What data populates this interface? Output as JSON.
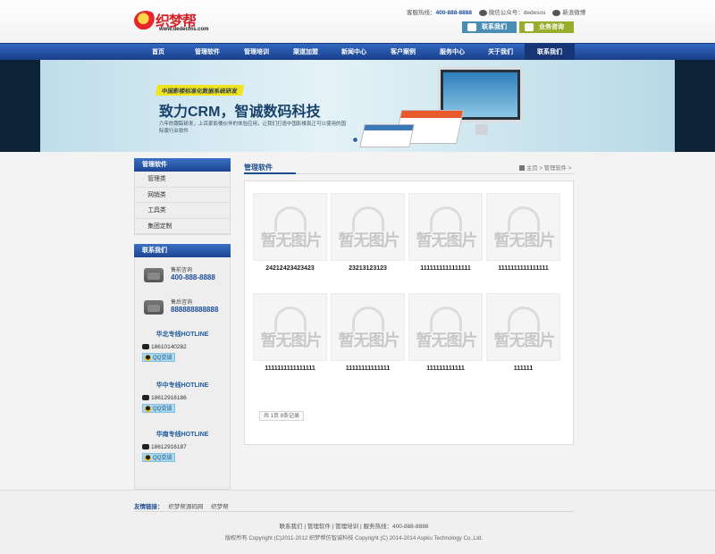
{
  "header": {
    "brand": "织梦帮",
    "url": "www.dedecms.com",
    "hotline_label": "客服热线：",
    "hotline": "400-888-8888",
    "wechat": "微信公众号：dedesos",
    "weibo": "新浪微博",
    "contact_button": "联系我们",
    "online_button": "业务咨询"
  },
  "nav": {
    "items": [
      "首页",
      "管理软件",
      "管理培训",
      "渠道加盟",
      "新闻中心",
      "客户案例",
      "服务中心",
      "关于我们",
      "联系我们"
    ],
    "active_index": 8
  },
  "banner": {
    "tag": "中国影楼标准化数据系统研发",
    "headline": "致力CRM，智诚数码科技",
    "sub": "六年的跟踪研发，上百家影楼伙伴的体验应用，让我们打造中国影楼真正可以使用的国际版行业软件"
  },
  "sidebar": {
    "category_title": "管理软件",
    "categories": [
      "管理类",
      "网销类",
      "工具类",
      "集团定制"
    ],
    "contact_title": "联系我们",
    "presale_label": "售前咨询",
    "presale_number": "400-888-8888",
    "aftersale_label": "售后咨询",
    "aftersale_number": "888888888888",
    "hotlines": [
      {
        "title": "华北专线HOTLINE",
        "phone": "18610140282",
        "qq": "QQ交谈"
      },
      {
        "title": "华中专线HOTLINE",
        "phone": "18612916186",
        "qq": "QQ交谈"
      },
      {
        "title": "华南专线HOTLINE",
        "phone": "18612916187",
        "qq": "QQ交谈"
      }
    ]
  },
  "main": {
    "title": "管理软件",
    "breadcrumb": "主页 > 管理软件 >",
    "placeholder_text": "暂无图片",
    "products": [
      "24212423423423",
      "23213123123",
      "1111111111111111",
      "1111111111111111",
      "1111111111111111",
      "11111111111111",
      "111111111111",
      "111111"
    ],
    "pager": "共 1页 8条记录"
  },
  "footer": {
    "links_label": "友情链接：",
    "links": [
      "织梦帮源码网",
      "织梦帮"
    ],
    "nav": "联系我们 | 管理软件 | 管理培训 | 服务热线：400-888-8888",
    "copyright": "版权所有 Copyright (C)2011-2012 织梦帮仿智诚科技 Copyright (C) 2014-2014 Aspku Technology Co.,Ltd."
  }
}
